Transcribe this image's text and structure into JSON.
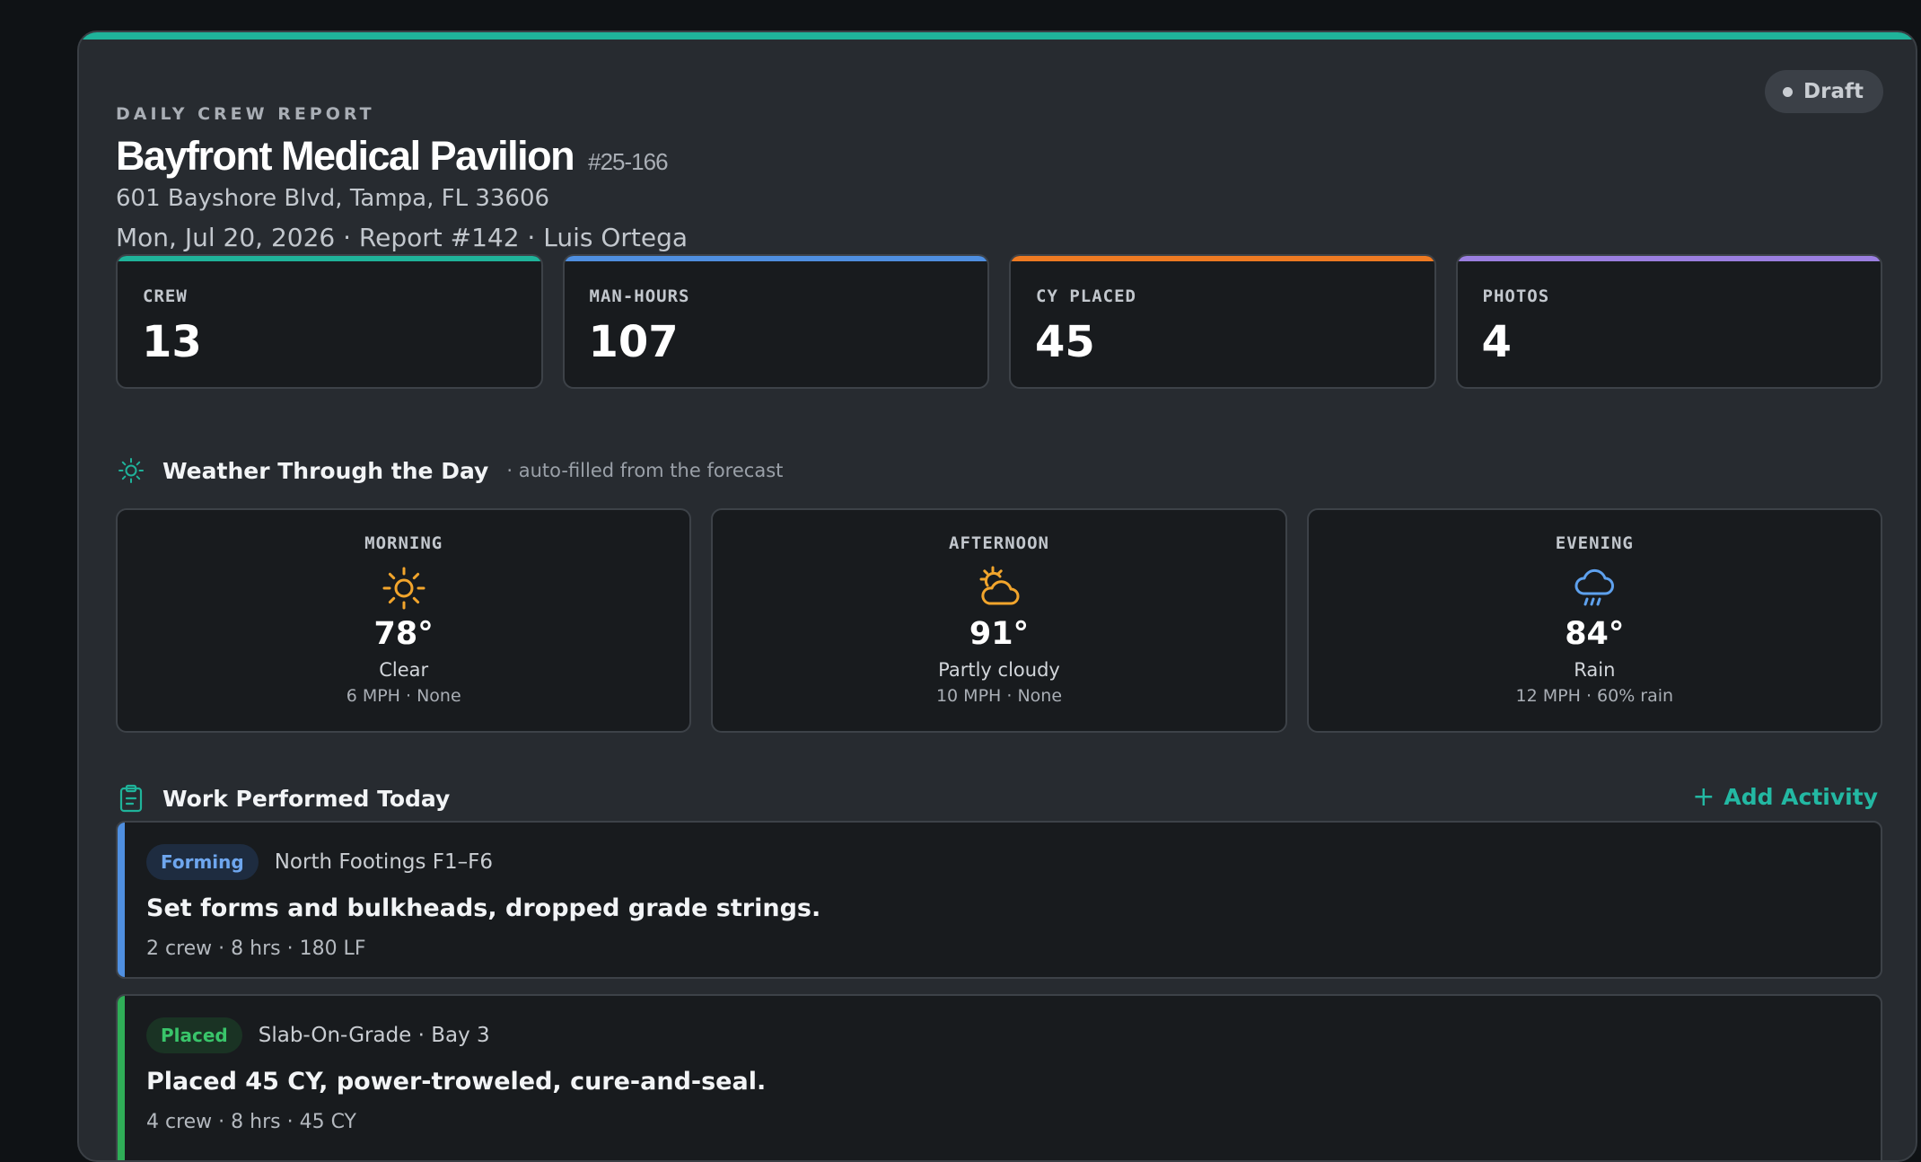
{
  "report": {
    "eyebrow": "DAILY CREW REPORT",
    "project_name": "Bayfront Medical Pavilion",
    "project_number": "#25-166",
    "address": "601 Bayshore Blvd, Tampa, FL 33606",
    "meta_line": "Mon, Jul 20, 2026 · Report #142 · Luis Ortega",
    "status": "Draft"
  },
  "stats": [
    {
      "label": "CREW",
      "value": "13",
      "color": "#1fb39a"
    },
    {
      "label": "MAN-HOURS",
      "value": "107",
      "color": "#4f8fe0"
    },
    {
      "label": "CY PLACED",
      "value": "45",
      "color": "#ee7a22"
    },
    {
      "label": "PHOTOS",
      "value": "4",
      "color": "#9b7fe0"
    }
  ],
  "weather": {
    "title": "Weather Through the Day",
    "subtitle": "· auto-filled from the forecast",
    "periods": [
      {
        "period": "MORNING",
        "icon": "sun-icon",
        "temp": "78°",
        "condition": "Clear",
        "detail": "6 MPH · None",
        "color": "#f2a52c"
      },
      {
        "period": "AFTERNOON",
        "icon": "partly-cloudy-icon",
        "temp": "91°",
        "condition": "Partly cloudy",
        "detail": "10 MPH · None",
        "color": "#f2a52c"
      },
      {
        "period": "EVENING",
        "icon": "rain-cloud-icon",
        "temp": "84°",
        "condition": "Rain",
        "detail": "12 MPH · 60% rain",
        "color": "#5ea1ee"
      }
    ]
  },
  "work": {
    "title": "Work Performed Today",
    "add_label": "Add Activity",
    "activities": [
      {
        "tag": "Forming",
        "location": "North Footings F1–F6",
        "description": "Set forms and bulkheads, dropped grade strings.",
        "meta": "2 crew · 8 hrs · 180 LF",
        "color": "#4f8fe0",
        "tag_bg": "#1e2c40",
        "tag_color": "#6ea6ee"
      },
      {
        "tag": "Placed",
        "location": "Slab-On-Grade · Bay 3",
        "description": "Placed 45 CY, power-troweled, cure-and-seal.",
        "meta": "4 crew · 8 hrs · 45 CY",
        "color": "#2fae57",
        "tag_bg": "#1a3324",
        "tag_color": "#39c46a"
      }
    ]
  }
}
